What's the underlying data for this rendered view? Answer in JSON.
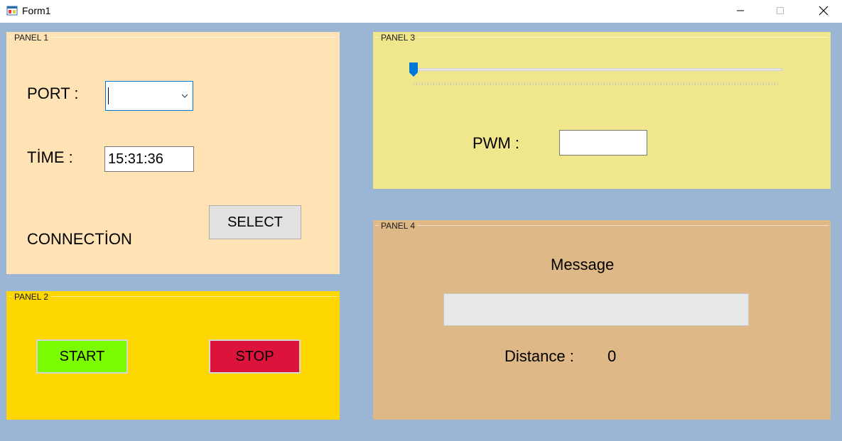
{
  "window": {
    "title": "Form1"
  },
  "colors": {
    "client_bg": "#9bb5d4",
    "panel1": "#ffe3b5",
    "panel2": "#ffd700",
    "panel3": "#f0e68c",
    "panel4": "#deb887",
    "start": "#7cfc00",
    "stop": "#dc143c",
    "slider_thumb": "#0078d7"
  },
  "panel1": {
    "caption": "PANEL 1",
    "port_label": "PORT :",
    "port_value": "",
    "time_label": "TİME :",
    "time_value": "15:31:36",
    "connection_label": "CONNECTİON",
    "select_label": "SELECT"
  },
  "panel2": {
    "caption": "PANEL 2",
    "start_label": "START",
    "stop_label": "STOP"
  },
  "panel3": {
    "caption": "PANEL 3",
    "slider_value": 0,
    "pwm_label": "PWM :",
    "pwm_value": ""
  },
  "panel4": {
    "caption": "PANEL 4",
    "message_label": "Message",
    "message_value": "",
    "distance_label": "Distance :",
    "distance_value": "0"
  },
  "icons": [
    "app-icon",
    "minimize-icon",
    "maximize-icon",
    "close-icon",
    "chevron-down-icon"
  ]
}
